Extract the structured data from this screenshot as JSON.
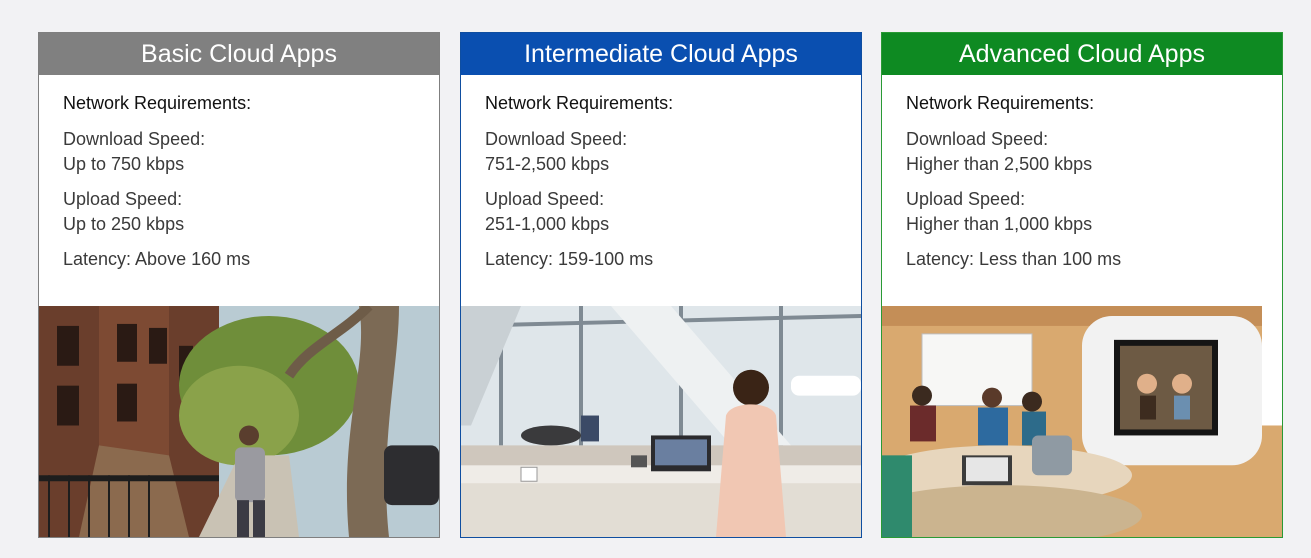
{
  "cards": [
    {
      "title": "Basic Cloud Apps",
      "header_color": "#808080",
      "requirements_label": "Network Requirements:",
      "download_label": "Download Speed:",
      "download_value": "Up to 750 kbps",
      "upload_label": "Upload Speed:",
      "upload_value": "Up to 250 kbps",
      "latency": "Latency: Above 160 ms",
      "photo": "street-scene-photo"
    },
    {
      "title": "Intermediate Cloud Apps",
      "header_color": "#0a4fb0",
      "requirements_label": "Network Requirements:",
      "download_label": "Download Speed:",
      "download_value": "751-2,500 kbps",
      "upload_label": "Upload Speed:",
      "upload_value": "251-1,000 kbps",
      "latency": "Latency: 159-100 ms",
      "photo": "airport-lounge-photo"
    },
    {
      "title": "Advanced Cloud Apps",
      "header_color": "#0e8a22",
      "requirements_label": "Network Requirements:",
      "download_label": "Download Speed:",
      "download_value": "Higher than 2,500 kbps",
      "upload_label": "Upload Speed:",
      "upload_value": "Higher than 1,000 kbps",
      "latency": "Latency: Less than 100 ms",
      "photo": "conference-room-photo"
    }
  ]
}
